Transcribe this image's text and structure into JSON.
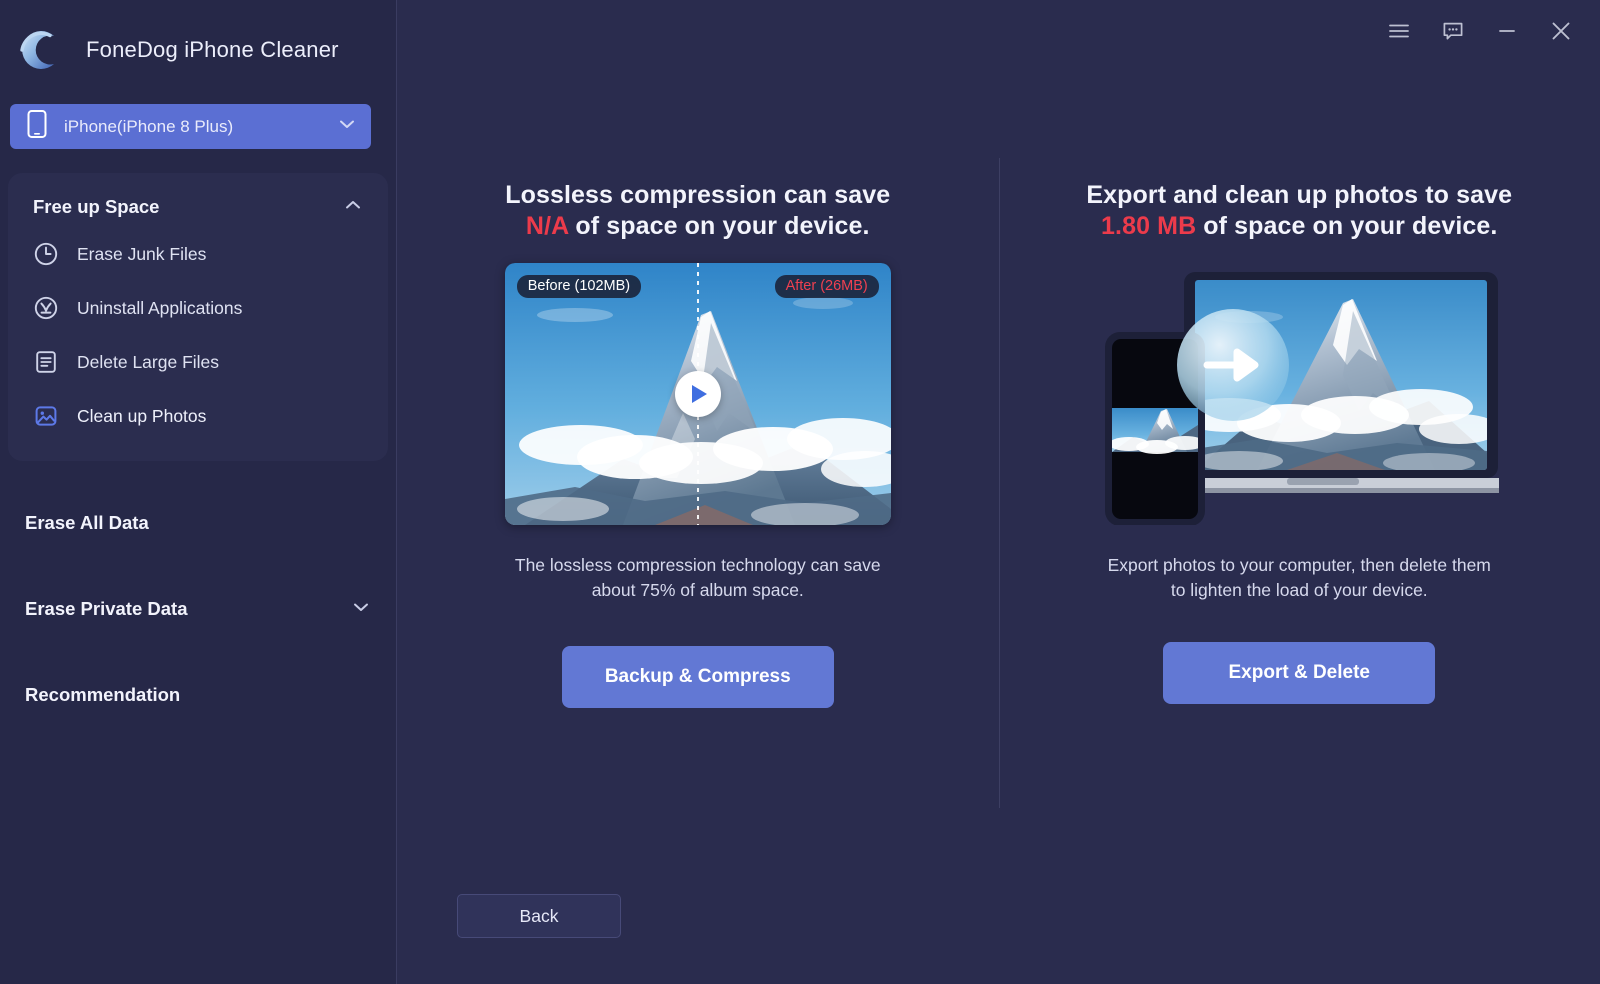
{
  "app": {
    "title": "FoneDog iPhone Cleaner",
    "logo_icon": "fonedog-c-logo"
  },
  "titlebar": {
    "menu_icon": "hamburger-menu-icon",
    "feedback_icon": "chat-bubble-icon",
    "minimize_icon": "minimize-icon",
    "close_icon": "close-icon"
  },
  "device_selector": {
    "icon": "phone-icon",
    "value": "iPhone(iPhone 8 Plus)",
    "chevron_icon": "chevron-down-icon"
  },
  "sidebar": {
    "groups": [
      {
        "label": "Free up Space",
        "expanded": true,
        "chevron_icon": "chevron-up-icon",
        "items": [
          {
            "label": "Erase Junk Files",
            "icon": "clock-icon",
            "active": false
          },
          {
            "label": "Uninstall Applications",
            "icon": "app-x-icon",
            "active": false
          },
          {
            "label": "Delete Large Files",
            "icon": "document-icon",
            "active": false
          },
          {
            "label": "Clean up Photos",
            "icon": "photo-icon",
            "active": true
          }
        ]
      }
    ],
    "sections": [
      {
        "label": "Erase All Data",
        "chevron": false
      },
      {
        "label": "Erase Private Data",
        "chevron": true,
        "chevron_icon": "chevron-down-icon"
      },
      {
        "label": "Recommendation",
        "chevron": false
      }
    ]
  },
  "main": {
    "left_panel": {
      "headline_pre": "Lossless compression can save",
      "headline_accent": "N/A",
      "headline_post": "of space on your device.",
      "media": {
        "type": "before-after-photo",
        "before_badge": "Before (102MB)",
        "after_badge": "After (26MB)",
        "play_icon": "play-icon"
      },
      "caption": "The lossless compression technology can save about 75% of album space.",
      "button_label": "Backup & Compress"
    },
    "right_panel": {
      "headline_pre": "Export and clean up photos to save",
      "headline_accent": "1.80 MB",
      "headline_post": "of space on your device.",
      "media": {
        "type": "phone-to-laptop-illustration",
        "transfer_icon": "arrow-right-icon"
      },
      "caption": "Export photos to your computer, then delete them to lighten the load of your device.",
      "button_label": "Export & Delete"
    },
    "back_label": "Back"
  },
  "colors": {
    "app_background": "#2a2c4e",
    "sidebar_background": "#262848",
    "accent_blue": "#6278d4",
    "selector_blue": "#5b6fd3",
    "accent_red": "#ec3b4b",
    "text_primary": "#f3f4fc",
    "text_secondary": "#d6d9ed"
  }
}
